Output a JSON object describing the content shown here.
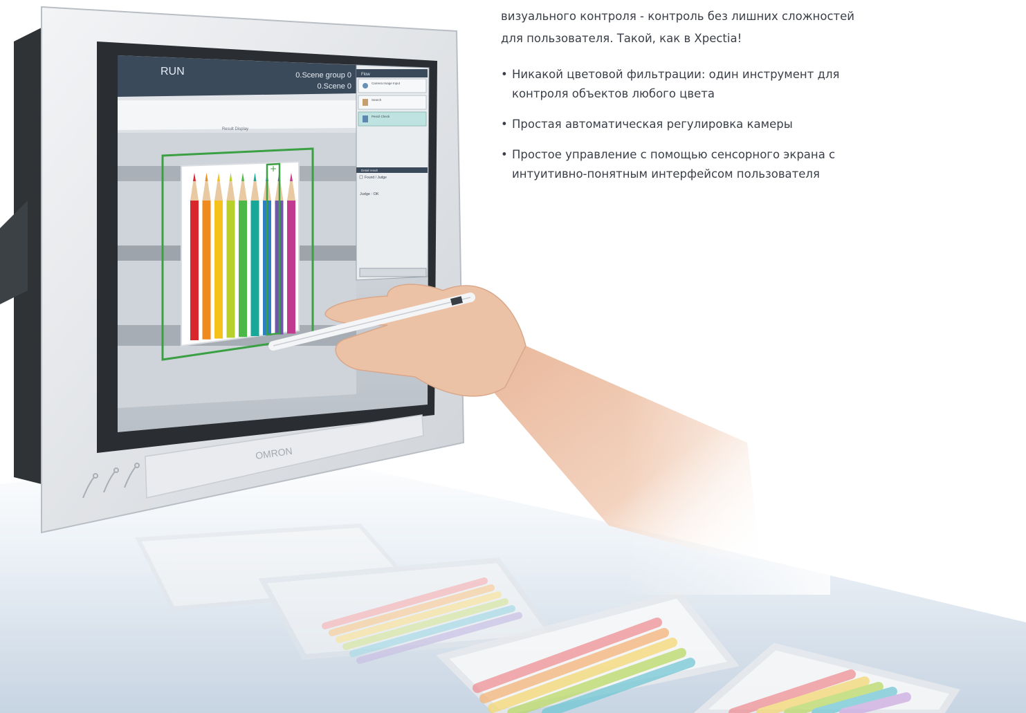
{
  "intro": {
    "line1": "визуального контроля - контроль без лишних сложностей",
    "line2": "для пользователя. Такой, как в Xpectia!"
  },
  "bullets": [
    {
      "text": "Никакой цветовой фильтрации: один инструмент для контроля объектов любого цвета"
    },
    {
      "text": "Простая автоматическая регулировка камеры"
    },
    {
      "text": "Простое управление с помощью сенсорного экрана с интуитивно-понятным интерфейсом пользователя"
    }
  ],
  "hmi": {
    "mode": "RUN",
    "scene_group": "0.Scene group 0",
    "scene": "0.Scene 0",
    "panel_title": "Flow",
    "flow_items": [
      "Camera Image Input",
      "Search",
      "Pencil Check"
    ],
    "detail_title": "Detail result",
    "detail_check": "Found / Judge",
    "judge": "Judge : OK",
    "result_title": "Result Display",
    "brand": "OMRON"
  },
  "colors": {
    "bezel": "#dfe2e6",
    "screen_header": "#3b4a5a",
    "roi_green": "#3aa043",
    "pencils": [
      "#d9252c",
      "#f08a1d",
      "#f5c21c",
      "#b9cf2b",
      "#4cb848",
      "#17a89a",
      "#2d7fc3",
      "#6f58a8",
      "#c23a8f"
    ]
  }
}
